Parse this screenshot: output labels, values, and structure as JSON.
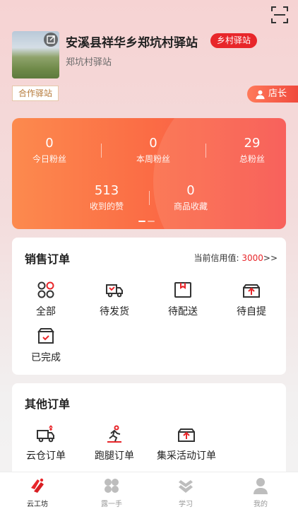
{
  "station": {
    "name": "安溪县祥华乡郑坑村驿站",
    "type_tag": "乡村驿站",
    "sub_name": "郑坑村驿站",
    "cooperation_tag": "合作驿站",
    "role": "店长"
  },
  "stats": {
    "items": [
      {
        "value": "0",
        "label": "今日粉丝"
      },
      {
        "value": "0",
        "label": "本周粉丝"
      },
      {
        "value": "29",
        "label": "总粉丝"
      },
      {
        "value": "513",
        "label": "收到的赞"
      },
      {
        "value": "0",
        "label": "商品收藏"
      }
    ]
  },
  "sales_orders": {
    "title": "销售订单",
    "credit_label": "当前信用值:",
    "credit_value": "3000",
    "credit_arrow": ">>",
    "items": [
      {
        "label": "全部",
        "icon": "circles-icon"
      },
      {
        "label": "待发货",
        "icon": "truck-icon"
      },
      {
        "label": "待配送",
        "icon": "box-icon"
      },
      {
        "label": "待自提",
        "icon": "gift-upload-icon"
      },
      {
        "label": "已完成",
        "icon": "bag-check-icon"
      }
    ]
  },
  "other_orders": {
    "title": "其他订单",
    "items": [
      {
        "label": "云仓订单",
        "icon": "cloud-truck-icon"
      },
      {
        "label": "跑腿订单",
        "icon": "runner-icon"
      },
      {
        "label": "集采活动订单",
        "icon": "gift-upload-icon"
      }
    ]
  },
  "tabbar": {
    "items": [
      {
        "label": "云工坊",
        "active": true
      },
      {
        "label": "露一手",
        "active": false
      },
      {
        "label": "学习",
        "active": false
      },
      {
        "label": "我的",
        "active": false
      }
    ]
  },
  "colors": {
    "accent": "#e8262a",
    "gradient_start": "#fc8a4e",
    "gradient_end": "#f8504a"
  }
}
